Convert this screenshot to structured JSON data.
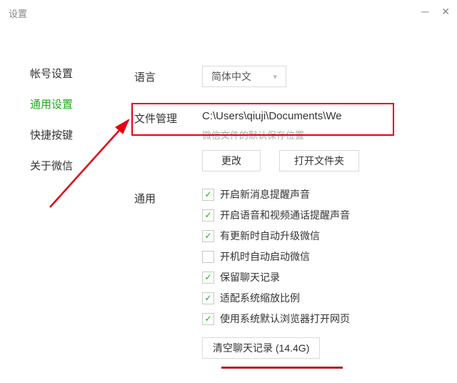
{
  "window": {
    "title": "设置"
  },
  "sidebar": {
    "items": [
      {
        "label": "帐号设置",
        "active": false
      },
      {
        "label": "通用设置",
        "active": true
      },
      {
        "label": "快捷按键",
        "active": false
      },
      {
        "label": "关于微信",
        "active": false
      }
    ]
  },
  "language": {
    "label": "语言",
    "selected": "简体中文"
  },
  "file_manage": {
    "label": "文件管理",
    "path": "C:\\Users\\qiuji\\Documents\\We",
    "hint": "微信文件的默认保存位置",
    "change_btn": "更改",
    "open_btn": "打开文件夹"
  },
  "general": {
    "label": "通用",
    "options": [
      {
        "label": "开启新消息提醒声音",
        "checked": true
      },
      {
        "label": "开启语音和视频通话提醒声音",
        "checked": true
      },
      {
        "label": "有更新时自动升级微信",
        "checked": true
      },
      {
        "label": "开机时自动启动微信",
        "checked": false
      },
      {
        "label": "保留聊天记录",
        "checked": true
      },
      {
        "label": "适配系统缩放比例",
        "checked": true
      },
      {
        "label": "使用系统默认浏览器打开网页",
        "checked": true
      }
    ],
    "clear_btn": "清空聊天记录 (14.4G)"
  }
}
